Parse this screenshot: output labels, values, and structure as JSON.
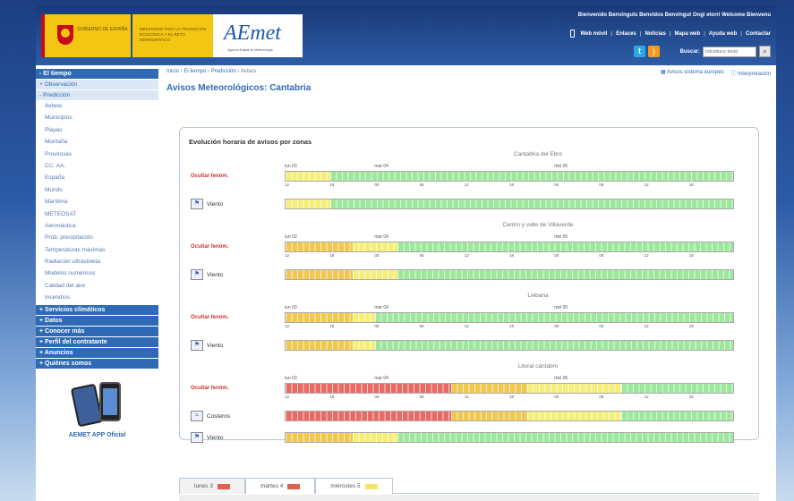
{
  "header": {
    "gob_text": "GOBIERNO DE ESPAÑA",
    "ministry_text": "MINISTERIO PARA LA TRANSICIÓN ECOLÓGICA Y EL RETO DEMOGRÁFICO",
    "logo_text": "AEmet",
    "logo_tag": "Agencia Estatal de Meteorología",
    "welcome": "Bienvenido Benvinguts Benvidos Benvingut Ongi etorri Welcome Bienvenu",
    "links": [
      "Web móvil",
      "Enlaces",
      "Noticias",
      "Mapa web",
      "Ayuda web",
      "Contactar"
    ],
    "search_label": "Buscar:",
    "search_placeholder": "Introduce texto"
  },
  "sidebar": {
    "head_tiempo": "El tiempo",
    "sub_observacion": "Observación",
    "sub_prediccion": "Predicción",
    "items": [
      "Avisos",
      "Municipios",
      "Playas",
      "Montaña",
      "Provincias",
      "CC. AA.",
      "España",
      "Mundo",
      "Marítima",
      "METEOSAT",
      "Aeronáutica",
      "Prob. precipitación",
      "Temperaturas máximas",
      "Radiación ultravioleta",
      "Modelos numéricos",
      "Calidad del aire",
      "Incendios"
    ],
    "sections": [
      "Servicios climáticos",
      "Datos",
      "Conocer más",
      "Perfil del contratante",
      "Anuncios",
      "Quiénes somos"
    ],
    "app_label": "AEMET APP Oficial"
  },
  "main": {
    "breadcrumb": [
      "Inicio",
      "El tiempo",
      "Predicción",
      "Avisos"
    ],
    "tool_links": [
      "Avisos sistema europeo",
      "Interpretación"
    ],
    "title": "Avisos Meteorológicos: Cantabria",
    "panel_title": "Evolución horaria de avisos por zonas",
    "days": [
      "lun 03",
      "mar 04",
      "mié 05"
    ],
    "hours": [
      "12",
      "18",
      "00",
      "06",
      "12",
      "18",
      "00",
      "06",
      "12",
      "18"
    ],
    "zones": [
      {
        "name": "Cantabria del Ebro",
        "rows": [
          {
            "label": "Ocultar fenóm.",
            "kind": "toggle",
            "segs": [
              [
                "y",
                0.1
              ],
              [
                "g",
                0.9
              ]
            ]
          },
          {
            "label": "Viento",
            "kind": "wind",
            "segs": [
              [
                "y",
                0.1
              ],
              [
                "g",
                0.9
              ]
            ]
          }
        ]
      },
      {
        "name": "Centro y valle de Villaverde",
        "rows": [
          {
            "label": "Ocultar fenóm.",
            "kind": "toggle",
            "segs": [
              [
                "o",
                0.15
              ],
              [
                "y",
                0.1
              ],
              [
                "g",
                0.75
              ]
            ]
          },
          {
            "label": "Viento",
            "kind": "wind",
            "segs": [
              [
                "o",
                0.15
              ],
              [
                "y",
                0.1
              ],
              [
                "g",
                0.75
              ]
            ]
          }
        ]
      },
      {
        "name": "Liébana",
        "rows": [
          {
            "label": "Ocultar fenóm.",
            "kind": "toggle",
            "segs": [
              [
                "o",
                0.15
              ],
              [
                "y",
                0.05
              ],
              [
                "g",
                0.8
              ]
            ]
          },
          {
            "label": "Viento",
            "kind": "wind",
            "segs": [
              [
                "o",
                0.15
              ],
              [
                "y",
                0.05
              ],
              [
                "g",
                0.8
              ]
            ]
          }
        ]
      },
      {
        "name": "Litoral cántabro",
        "rows": [
          {
            "label": "Ocultar fenóm.",
            "kind": "toggle",
            "segs": [
              [
                "r",
                0.37
              ],
              [
                "o",
                0.17
              ],
              [
                "y",
                0.21
              ],
              [
                "g",
                0.25
              ]
            ]
          },
          {
            "label": "Costeros",
            "kind": "coast",
            "segs": [
              [
                "r",
                0.37
              ],
              [
                "o",
                0.17
              ],
              [
                "y",
                0.21
              ],
              [
                "g",
                0.25
              ]
            ]
          },
          {
            "label": "Viento",
            "kind": "wind",
            "segs": [
              [
                "o",
                0.15
              ],
              [
                "y",
                0.1
              ],
              [
                "g",
                0.75
              ]
            ]
          }
        ]
      }
    ],
    "tabs": [
      {
        "label": "lunes 3",
        "color": "#e06050"
      },
      {
        "label": "martes 4",
        "color": "#e06050"
      },
      {
        "label": "miércoles 5",
        "color": "#f4e46a"
      }
    ]
  },
  "colors": {
    "g": "#9ee89e",
    "y": "#f6ee7a",
    "o": "#f0c850",
    "r": "#e86a64",
    "accent": "#2f6bb5"
  }
}
